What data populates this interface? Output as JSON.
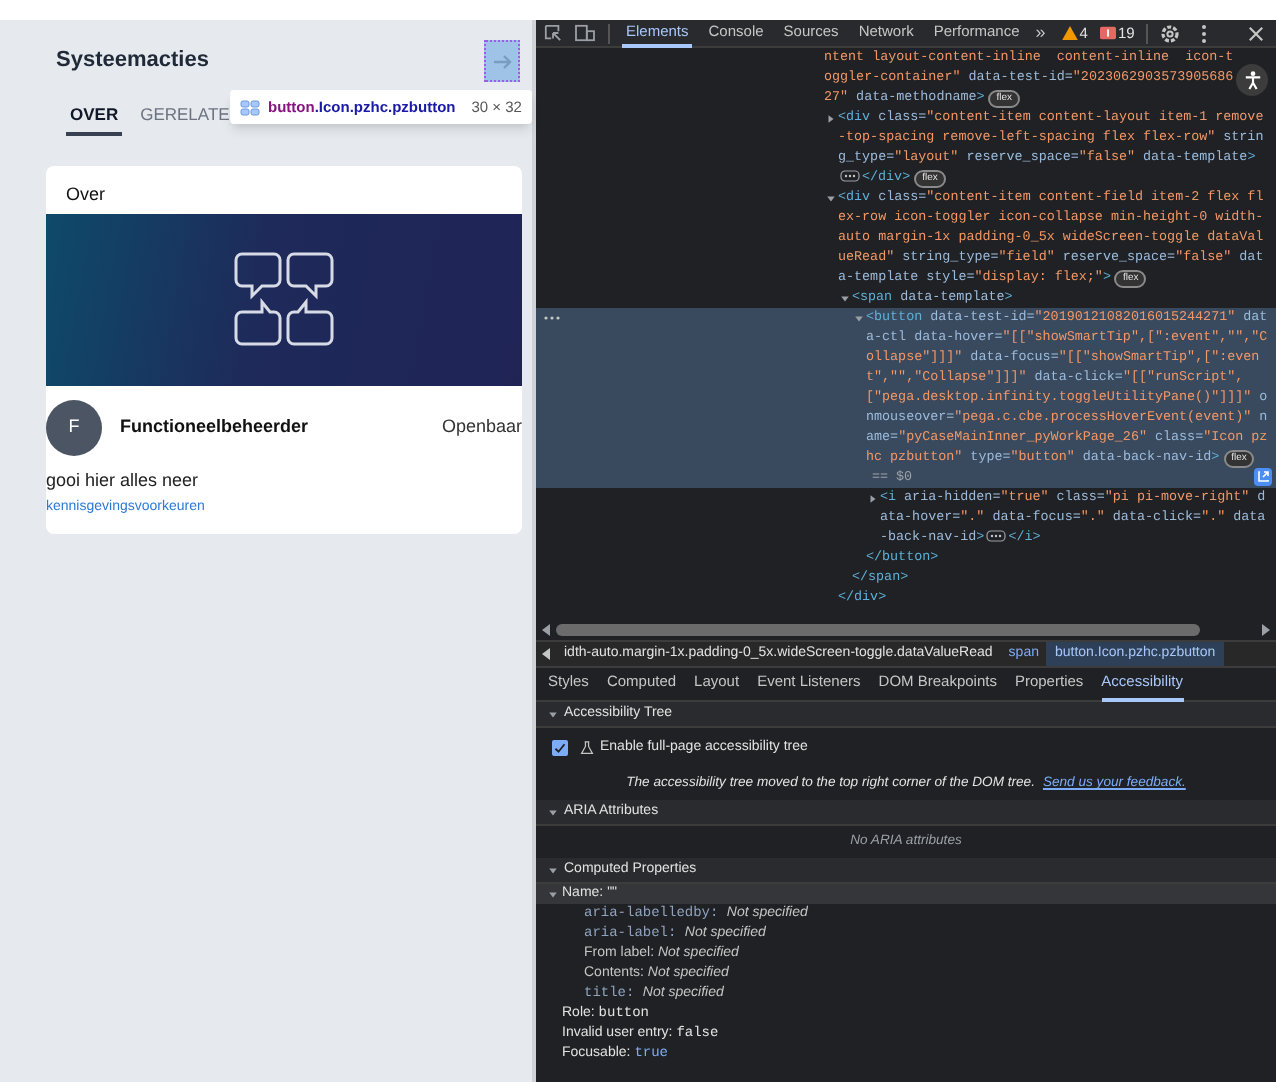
{
  "left_panel": {
    "title": "Systeemacties",
    "tabs": [
      {
        "label": "OVER",
        "selected": true
      },
      {
        "label": "GERELATE",
        "selected": false
      }
    ],
    "tooltip": {
      "tag": "button",
      "classes": ".Icon.pzhc.pzbutton",
      "size": "30 × 32"
    },
    "card": {
      "title": "Over",
      "author": {
        "initial": "F",
        "name": "Functioneelbeheerder",
        "visibility": "Openbaar"
      },
      "description": "gooi hier alles neer",
      "link": "kennisgevingsvoorkeuren"
    }
  },
  "devtools": {
    "tabs": [
      {
        "label": "Elements",
        "selected": true
      },
      {
        "label": "Console",
        "selected": false
      },
      {
        "label": "Sources",
        "selected": false
      },
      {
        "label": "Network",
        "selected": false
      },
      {
        "label": "Performance",
        "selected": false
      }
    ],
    "more": "»",
    "warnings": "4",
    "errors": "19",
    "dom_tree": {
      "selected": false,
      "tokens": [
        {
          "kind": "value",
          "text": "ntent layout-content-inline  content-inline  icon-toggler-container\""
        },
        {
          "kind": "attr",
          "text": " data-test-id="
        },
        {
          "kind": "value",
          "text": "\"202306290357390568627\""
        },
        {
          "kind": "attr",
          "text": " data-methodname"
        },
        {
          "kind": "tag",
          "text": ">"
        }
      ],
      "badge": "flex",
      "children": [
        {
          "expanded": false,
          "selected": false,
          "tokens": [
            {
              "kind": "tag",
              "text": "<div"
            },
            {
              "kind": "attr",
              "text": " class="
            },
            {
              "kind": "value",
              "text": "\"content-item content-layout item-1 remove-top-spacing remove-left-spacing flex flex-row\""
            },
            {
              "kind": "attr",
              "text": " string_type="
            },
            {
              "kind": "value",
              "text": "\"layout\""
            },
            {
              "kind": "attr",
              "text": " reserve_space="
            },
            {
              "kind": "value",
              "text": "\"false\""
            },
            {
              "kind": "attr",
              "text": " data-template"
            },
            {
              "kind": "tag",
              "text": ">"
            }
          ],
          "ellipsis": true,
          "close_inline": "</div>",
          "badge": "flex"
        },
        {
          "expanded": true,
          "selected": false,
          "tokens": [
            {
              "kind": "tag",
              "text": "<div"
            },
            {
              "kind": "attr",
              "text": " class="
            },
            {
              "kind": "value",
              "text": "\"content-item content-field item-2 flex flex-row icon-toggler icon-collapse min-height-0 width-auto margin-1x padding-0_5x wideScreen-toggle dataValueRead\""
            },
            {
              "kind": "attr",
              "text": " string_type="
            },
            {
              "kind": "value",
              "text": "\"field\""
            },
            {
              "kind": "attr",
              "text": " reserve_space="
            },
            {
              "kind": "value",
              "text": "\"false\""
            },
            {
              "kind": "attr",
              "text": " data-template style="
            },
            {
              "kind": "value",
              "text": "\"display: flex;\""
            },
            {
              "kind": "tag",
              "text": ">"
            }
          ],
          "badge": "flex",
          "close": "</div>",
          "children": [
            {
              "expanded": true,
              "selected": false,
              "tokens": [
                {
                  "kind": "tag",
                  "text": "<span"
                },
                {
                  "kind": "attr",
                  "text": " data-template"
                },
                {
                  "kind": "tag",
                  "text": ">"
                }
              ],
              "close": "</span>",
              "children": [
                {
                  "expanded": true,
                  "selected": true,
                  "tokens": [
                    {
                      "kind": "tag",
                      "text": "<button"
                    },
                    {
                      "kind": "attr",
                      "text": " data-test-id="
                    },
                    {
                      "kind": "value",
                      "text": "\"20190121082016015244271\""
                    },
                    {
                      "kind": "attr",
                      "text": " data-ctl data-hover="
                    },
                    {
                      "kind": "value",
                      "text": "\"[[\"showSmartTip\",[\":event\",\"\",\"Collapse\"]]]\""
                    },
                    {
                      "kind": "attr",
                      "text": " data-focus="
                    },
                    {
                      "kind": "value",
                      "text": "\"[[\"showSmartTip\",[\":event\",\"\",\"Collapse\"]]]\""
                    },
                    {
                      "kind": "attr",
                      "text": " data-click="
                    },
                    {
                      "kind": "value",
                      "text": "\"[[\"runScript\", [\"pega.desktop.infinity.toggleUtilityPane()\"]]]\""
                    },
                    {
                      "kind": "attr",
                      "text": " onmouseover="
                    },
                    {
                      "kind": "value",
                      "text": "\"pega.c.cbe.processHoverEvent(event)\""
                    },
                    {
                      "kind": "attr",
                      "text": " name="
                    },
                    {
                      "kind": "value",
                      "text": "\"pyCaseMainInner_pyWorkPage_26\""
                    },
                    {
                      "kind": "attr",
                      "text": " class="
                    },
                    {
                      "kind": "value",
                      "text": "\"Icon pzhc pzbutton\""
                    },
                    {
                      "kind": "attr",
                      "text": " type="
                    },
                    {
                      "kind": "value",
                      "text": "\"button\""
                    },
                    {
                      "kind": "attr",
                      "text": " data-back-nav-id"
                    },
                    {
                      "kind": "tag",
                      "text": ">"
                    }
                  ],
                  "badge": "flex",
                  "tail": "== $0",
                  "close": "</button>",
                  "children": [
                    {
                      "expanded": false,
                      "selected": false,
                      "tokens": [
                        {
                          "kind": "tag",
                          "text": "<i"
                        },
                        {
                          "kind": "attr",
                          "text": " aria-hidden="
                        },
                        {
                          "kind": "value",
                          "text": "\"true\""
                        },
                        {
                          "kind": "attr",
                          "text": " class="
                        },
                        {
                          "kind": "value",
                          "text": "\"pi pi-move-right\""
                        },
                        {
                          "kind": "attr",
                          "text": " data-hover="
                        },
                        {
                          "kind": "value",
                          "text": "\".\""
                        },
                        {
                          "kind": "attr",
                          "text": " data-focus="
                        },
                        {
                          "kind": "value",
                          "text": "\".\""
                        },
                        {
                          "kind": "attr",
                          "text": " data-click="
                        },
                        {
                          "kind": "value",
                          "text": "\".\""
                        },
                        {
                          "kind": "attr",
                          "text": " data-back-nav-id"
                        },
                        {
                          "kind": "tag",
                          "text": ">"
                        }
                      ],
                      "ellipsis": true,
                      "close_inline": "</i>"
                    }
                  ]
                }
              ]
            }
          ]
        }
      ]
    },
    "breadcrumbs": [
      {
        "classes": "idth-auto.margin-1x.padding-0_5x.wideScreen-toggle.dataValueRead",
        "selected": false
      },
      {
        "tag": "span",
        "selected": false
      },
      {
        "tag": "button",
        "classes": ".Icon.pzhc.pzbutton",
        "selected": true
      }
    ],
    "sidebar_tabs": [
      {
        "label": "Styles",
        "selected": false
      },
      {
        "label": "Computed",
        "selected": false
      },
      {
        "label": "Layout",
        "selected": false
      },
      {
        "label": "Event Listeners",
        "selected": false
      },
      {
        "label": "DOM Breakpoints",
        "selected": false
      },
      {
        "label": "Properties",
        "selected": false
      },
      {
        "label": "Accessibility",
        "selected": true
      }
    ],
    "accessibility": {
      "sections": [
        {
          "kind": "tree",
          "title": "Accessibility Tree",
          "expanded": true,
          "checkbox": {
            "label": "Enable full-page accessibility tree",
            "checked": true
          },
          "note": "The accessibility tree moved to the top right corner of the DOM tree.",
          "link": "Send us your feedback."
        },
        {
          "kind": "aria",
          "title": "ARIA Attributes",
          "expanded": true,
          "empty": "No ARIA attributes"
        },
        {
          "kind": "computed",
          "title": "Computed Properties",
          "expanded": true,
          "properties": [
            {
              "name": "Name:",
              "value": "\"\"",
              "kind": "plain",
              "selected": true,
              "expanded": true,
              "sources": [
                {
                  "key": "aria-labelledby:",
                  "kind": "code",
                  "value": "Not specified"
                },
                {
                  "key": "aria-label:",
                  "kind": "code",
                  "value": "Not specified"
                },
                {
                  "key": "From label:",
                  "kind": "plain",
                  "value": "Not specified"
                },
                {
                  "key": "Contents:",
                  "kind": "plain",
                  "value": "Not specified"
                },
                {
                  "key": "title:",
                  "kind": "code",
                  "value": "Not specified"
                }
              ]
            },
            {
              "name": "Role:",
              "value": "button",
              "kind": "code",
              "selected": false
            },
            {
              "name": "Invalid user entry:",
              "value": "false",
              "kind": "code",
              "selected": false
            },
            {
              "name": "Focusable:",
              "value": "true",
              "kind": "keyword",
              "selected": false
            }
          ]
        }
      ]
    }
  }
}
